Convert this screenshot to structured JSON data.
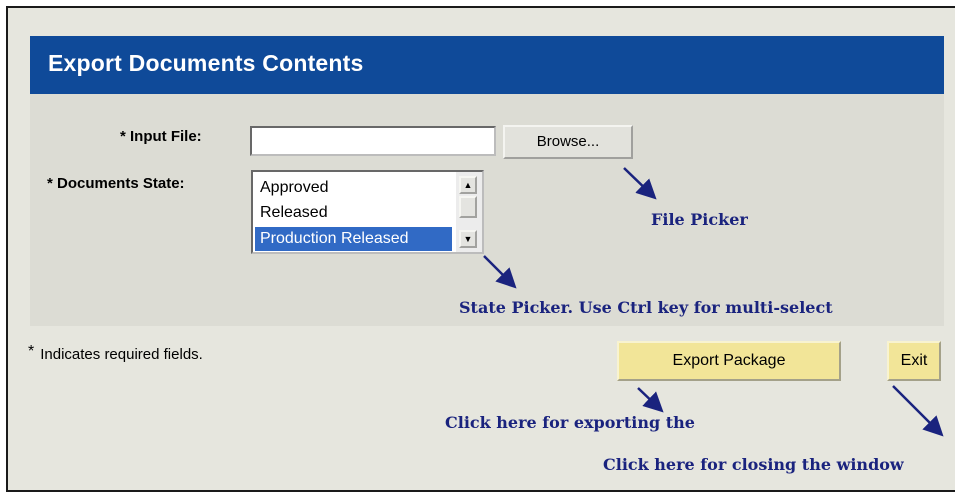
{
  "header": {
    "title": "Export Documents Contents"
  },
  "form": {
    "input_file_label": "* Input File:",
    "input_file_value": "",
    "browse_label": "Browse...",
    "documents_state_label": "* Documents State:",
    "states": [
      "Approved",
      "Released",
      "Production Released"
    ],
    "selected_state": "Production Released"
  },
  "footer": {
    "required_star": "*",
    "required_text": "Indicates required fields.",
    "export_label": "Export Package",
    "exit_label": "Exit"
  },
  "annotations": {
    "file_picker": "File Picker",
    "state_picker": "State Picker. Use Ctrl key for multi-select",
    "export_hint": "Click here for exporting the",
    "exit_hint": "Click here for closing the window"
  },
  "colors": {
    "header_bg": "#0f4a99",
    "selection": "#316ac5",
    "button_yellow": "#f2e598",
    "annotation": "#1a237e"
  }
}
